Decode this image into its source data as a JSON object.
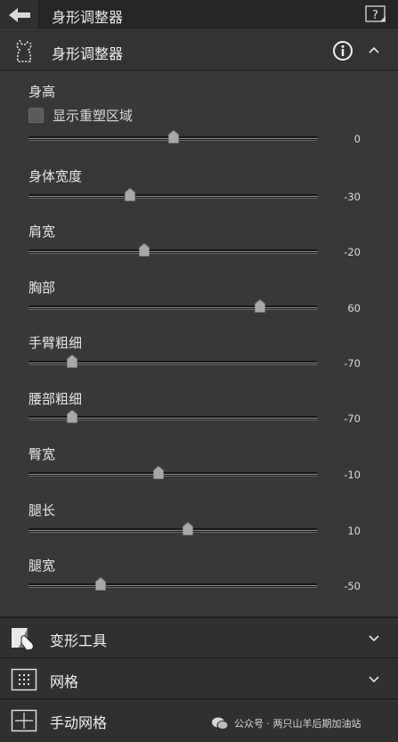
{
  "window": {
    "title": "身形调整器"
  },
  "panel": {
    "title": "身形调整器"
  },
  "height_section": {
    "label": "身高"
  },
  "show_area": {
    "label": "显示重塑区域",
    "checked": false
  },
  "sliders": [
    {
      "id": "height",
      "label": "",
      "value": "0",
      "numeric": 0
    },
    {
      "id": "body-width",
      "label": "身体宽度",
      "value": "-30",
      "numeric": -30
    },
    {
      "id": "shoulder-width",
      "label": "肩宽",
      "value": "-20",
      "numeric": -20
    },
    {
      "id": "chest",
      "label": "胸部",
      "value": "60",
      "numeric": 60
    },
    {
      "id": "arm-thickness",
      "label": "手臂粗细",
      "value": "-70",
      "numeric": -70
    },
    {
      "id": "waist-thickness",
      "label": "腰部粗细",
      "value": "-70",
      "numeric": -70
    },
    {
      "id": "hip-width",
      "label": "臀宽",
      "value": "-10",
      "numeric": -10
    },
    {
      "id": "leg-length",
      "label": "腿长",
      "value": "10",
      "numeric": 10
    },
    {
      "id": "leg-width",
      "label": "腿宽",
      "value": "-50",
      "numeric": -50
    }
  ],
  "sections": [
    {
      "label": "变形工具",
      "icon": "warp-tool-icon"
    },
    {
      "label": "网格",
      "icon": "grid-icon"
    },
    {
      "label": "手动网格",
      "icon": "manual-grid-icon"
    }
  ],
  "watermark": {
    "text": "公众号 · 两只山羊后期加油站"
  },
  "slider_range": [
    -100,
    100
  ]
}
